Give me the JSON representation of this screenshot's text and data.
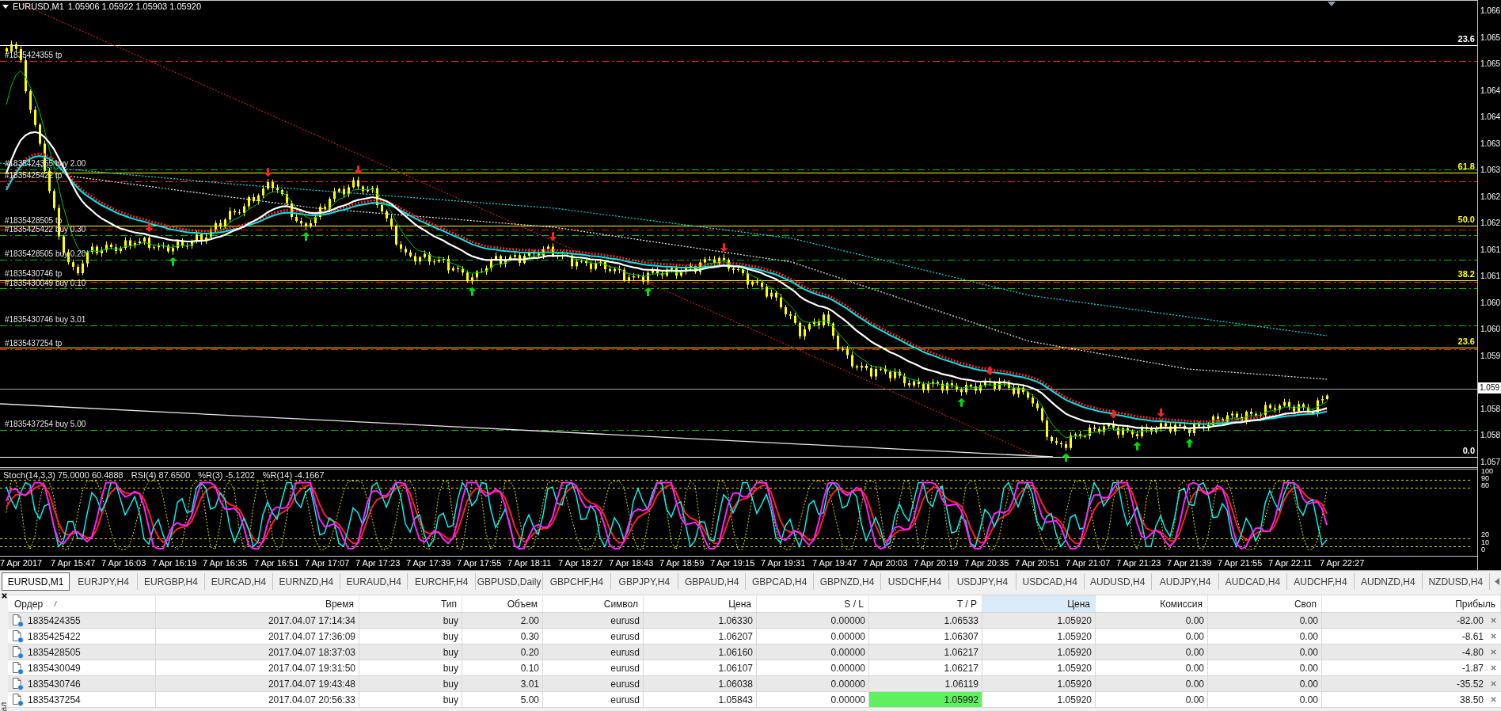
{
  "chart": {
    "symbol": "EURUSD,M1",
    "quote": "1.05906 1.05922 1.05903 1.05920",
    "order_lines": [
      {
        "label": "#1835424355 tp",
        "kind": "tp"
      },
      {
        "label": "#1835424355 buy 2.00",
        "kind": "entry"
      },
      {
        "label": "#1835425422 tp",
        "kind": "tp"
      },
      {
        "label": "#1835428505 tp",
        "kind": "tp"
      },
      {
        "label": "#1835425422 buy 0.30",
        "kind": "entry"
      },
      {
        "label": "#1835428505 buy 0.20",
        "kind": "entry"
      },
      {
        "label": "#1835430746 tp",
        "kind": "tp"
      },
      {
        "label": "#1835430049 buy 0.10",
        "kind": "entry"
      },
      {
        "label": "#1835430746 buy 3.01",
        "kind": "entry"
      },
      {
        "label": "#1835437254 tp",
        "kind": "tp"
      },
      {
        "label": "#1835437254 buy 5.00",
        "kind": "entry"
      }
    ],
    "fib_levels": [
      {
        "label": "23.6",
        "color": "#ffffff"
      },
      {
        "label": "61.8",
        "color": "#ffff00"
      },
      {
        "label": "50.0",
        "color": "#ffff00"
      },
      {
        "label": "38.2",
        "color": "#ffff00"
      },
      {
        "label": "23.6",
        "color": "#ffff00"
      },
      {
        "label": "0.0",
        "color": "#ffffff"
      }
    ],
    "price_axis": {
      "labels": [
        "1.066",
        "1.065",
        "1.065",
        "1.064",
        "1.064",
        "1.063",
        "1.063",
        "1.062",
        "1.062",
        "1.061",
        "1.061",
        "1.060",
        "1.060",
        "1.059",
        "1.058",
        "1.058",
        "1.057"
      ],
      "current_price": "1.059"
    },
    "indicator": {
      "readouts": [
        "Stoch(14,3,3) 75.0000 60.4888",
        "RSI(4) 87.6500",
        "%R(3) -5.1202",
        "%R(14) -4.1667"
      ],
      "levels": [
        "100",
        "90",
        "80",
        "20",
        "10",
        "0"
      ]
    },
    "time_axis": [
      "7 Apr 2017",
      "7 Apr 15:47",
      "7 Apr 16:03",
      "7 Apr 16:19",
      "7 Apr 16:35",
      "7 Apr 16:51",
      "7 Apr 17:07",
      "7 Apr 17:23",
      "7 Apr 17:39",
      "7 Apr 17:55",
      "7 Apr 18:11",
      "7 Apr 18:27",
      "7 Apr 18:43",
      "7 Apr 18:59",
      "7 Apr 19:15",
      "7 Apr 19:31",
      "7 Apr 19:47",
      "7 Apr 20:03",
      "7 Apr 20:19",
      "7 Apr 20:35",
      "7 Apr 20:51",
      "7 Apr 21:07",
      "7 Apr 21:23",
      "7 Apr 21:39",
      "7 Apr 21:55",
      "7 Apr 22:11",
      "7 Apr 22:27"
    ]
  },
  "tabs": [
    {
      "label": "EURUSD,M1",
      "selected": true
    },
    {
      "label": "EURJPY,H4",
      "selected": false
    },
    {
      "label": "EURGBP,H4",
      "selected": false
    },
    {
      "label": "EURCAD,H4",
      "selected": false
    },
    {
      "label": "EURNZD,H4",
      "selected": false
    },
    {
      "label": "EURAUD,H4",
      "selected": false
    },
    {
      "label": "EURCHF,H4",
      "selected": false
    },
    {
      "label": "GBPUSD,Daily",
      "selected": false
    },
    {
      "label": "GBPCHF,H4",
      "selected": false
    },
    {
      "label": "GBPJPY,H4",
      "selected": false
    },
    {
      "label": "GBPAUD,H4",
      "selected": false
    },
    {
      "label": "GBPCAD,H4",
      "selected": false
    },
    {
      "label": "GBPNZD,H4",
      "selected": false
    },
    {
      "label": "USDCHF,H4",
      "selected": false
    },
    {
      "label": "USDJPY,H4",
      "selected": false
    },
    {
      "label": "USDCAD,H4",
      "selected": false
    },
    {
      "label": "AUDUSD,H4",
      "selected": false
    },
    {
      "label": "AUDJPY,H4",
      "selected": false
    },
    {
      "label": "AUDCAD,H4",
      "selected": false
    },
    {
      "label": "AUDCHF,H4",
      "selected": false
    },
    {
      "label": "AUDNZD,H4",
      "selected": false
    },
    {
      "label": "NZDUSD,H4",
      "selected": false
    }
  ],
  "terminal": {
    "side_label": "ал"
  },
  "orders_table": {
    "columns": [
      {
        "label": "Ордер",
        "sorted": true,
        "highlighted": false
      },
      {
        "label": "Время",
        "sorted": false,
        "highlighted": false
      },
      {
        "label": "Тип",
        "sorted": false,
        "highlighted": false
      },
      {
        "label": "Объем",
        "sorted": false,
        "highlighted": false
      },
      {
        "label": "Символ",
        "sorted": false,
        "highlighted": false
      },
      {
        "label": "Цена",
        "sorted": false,
        "highlighted": false
      },
      {
        "label": "S / L",
        "sorted": false,
        "highlighted": false
      },
      {
        "label": "T / P",
        "sorted": false,
        "highlighted": false
      },
      {
        "label": "Цена",
        "sorted": false,
        "highlighted": true
      },
      {
        "label": "Комиссия",
        "sorted": false,
        "highlighted": false
      },
      {
        "label": "Своп",
        "sorted": false,
        "highlighted": false
      },
      {
        "label": "Прибыль",
        "sorted": false,
        "highlighted": false
      }
    ],
    "rows": [
      {
        "cells": [
          "1835424355",
          "2017.04.07 17:14:34",
          "buy",
          "2.00",
          "eurusd",
          "1.06330",
          "0.00000",
          "1.06533",
          "1.05920",
          "0.00",
          "0.00",
          "-82.00"
        ],
        "tp_highlight": false
      },
      {
        "cells": [
          "1835425422",
          "2017.04.07 17:36:09",
          "buy",
          "0.30",
          "eurusd",
          "1.06207",
          "0.00000",
          "1.06307",
          "1.05920",
          "0.00",
          "0.00",
          "-8.61"
        ],
        "tp_highlight": false
      },
      {
        "cells": [
          "1835428505",
          "2017.04.07 18:37:03",
          "buy",
          "0.20",
          "eurusd",
          "1.06160",
          "0.00000",
          "1.06217",
          "1.05920",
          "0.00",
          "0.00",
          "-4.80"
        ],
        "tp_highlight": false
      },
      {
        "cells": [
          "1835430049",
          "2017.04.07 19:31:50",
          "buy",
          "0.10",
          "eurusd",
          "1.06107",
          "0.00000",
          "1.06217",
          "1.05920",
          "0.00",
          "0.00",
          "-1.87"
        ],
        "tp_highlight": false
      },
      {
        "cells": [
          "1835430746",
          "2017.04.07 19:43:48",
          "buy",
          "3.01",
          "eurusd",
          "1.06038",
          "0.00000",
          "1.06119",
          "1.05920",
          "0.00",
          "0.00",
          "-35.52"
        ],
        "tp_highlight": false
      },
      {
        "cells": [
          "1835437254",
          "2017.04.07 20:56:33",
          "buy",
          "5.00",
          "eurusd",
          "1.05843",
          "0.00000",
          "1.05992",
          "1.05920",
          "0.00",
          "0.00",
          "38.50"
        ],
        "tp_highlight": true
      }
    ]
  }
}
